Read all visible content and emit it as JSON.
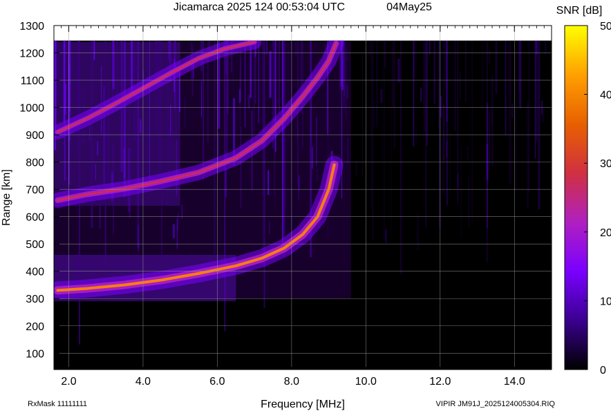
{
  "header": {
    "title": "Jicamarca 2025 124 00:53:04 UTC",
    "date": "04May25"
  },
  "footer": {
    "left": "RxMask 11111111",
    "right": "VIPIR  JM91J_2025124005304.RIQ"
  },
  "chart_data": {
    "type": "heatmap",
    "title": "Jicamarca 2025 124 00:53:04 UTC",
    "xlabel": "Frequency [MHz]",
    "ylabel": "Range [km]",
    "xlim": [
      1.6,
      15.0
    ],
    "ylim": [
      40,
      1300
    ],
    "x_ticks": [
      "2.0",
      "4.0",
      "6.0",
      "8.0",
      "10.0",
      "12.0",
      "14.0"
    ],
    "x_tick_values": [
      2,
      4,
      6,
      8,
      10,
      12,
      14
    ],
    "y_ticks": [
      "100",
      "200",
      "300",
      "400",
      "500",
      "600",
      "700",
      "800",
      "900",
      "1000",
      "1100",
      "1200",
      "1300"
    ],
    "y_tick_values": [
      100,
      200,
      300,
      400,
      500,
      600,
      700,
      800,
      900,
      1000,
      1100,
      1200,
      1300
    ],
    "data_max_range": 1245,
    "grid": true,
    "colorbar": {
      "label": "SNR [dB]",
      "range": [
        0,
        50
      ],
      "ticks": [
        "0",
        "10",
        "20",
        "30",
        "40",
        "50"
      ],
      "tick_values": [
        0,
        10,
        20,
        30,
        40,
        50
      ],
      "colors": [
        "#000000",
        "#3a0090",
        "#7a00ff",
        "#b020c0",
        "#d03040",
        "#e86000",
        "#ffa000",
        "#ffff00"
      ]
    },
    "traces": [
      {
        "points": [
          [
            1.7,
            330
          ],
          [
            2.5,
            337
          ],
          [
            3.5,
            350
          ],
          [
            4.5,
            368
          ],
          [
            5.5,
            392
          ],
          [
            6.5,
            420
          ],
          [
            7.2,
            448
          ],
          [
            7.8,
            485
          ],
          [
            8.3,
            535
          ],
          [
            8.7,
            600
          ],
          [
            9.0,
            700
          ],
          [
            9.15,
            790
          ]
        ]
      },
      {
        "points": [
          [
            1.7,
            660
          ],
          [
            2.5,
            682
          ],
          [
            3.5,
            702
          ],
          [
            4.5,
            730
          ],
          [
            5.5,
            762
          ],
          [
            6.5,
            815
          ],
          [
            7.2,
            878
          ],
          [
            7.8,
            960
          ],
          [
            8.3,
            1040
          ],
          [
            8.7,
            1110
          ],
          [
            9.0,
            1170
          ],
          [
            9.2,
            1235
          ]
        ]
      },
      {
        "points": [
          [
            1.7,
            910
          ],
          [
            2.5,
            960
          ],
          [
            3.2,
            1010
          ],
          [
            4.0,
            1070
          ],
          [
            4.8,
            1130
          ],
          [
            5.5,
            1180
          ],
          [
            6.2,
            1215
          ],
          [
            7.0,
            1240
          ]
        ]
      }
    ]
  }
}
